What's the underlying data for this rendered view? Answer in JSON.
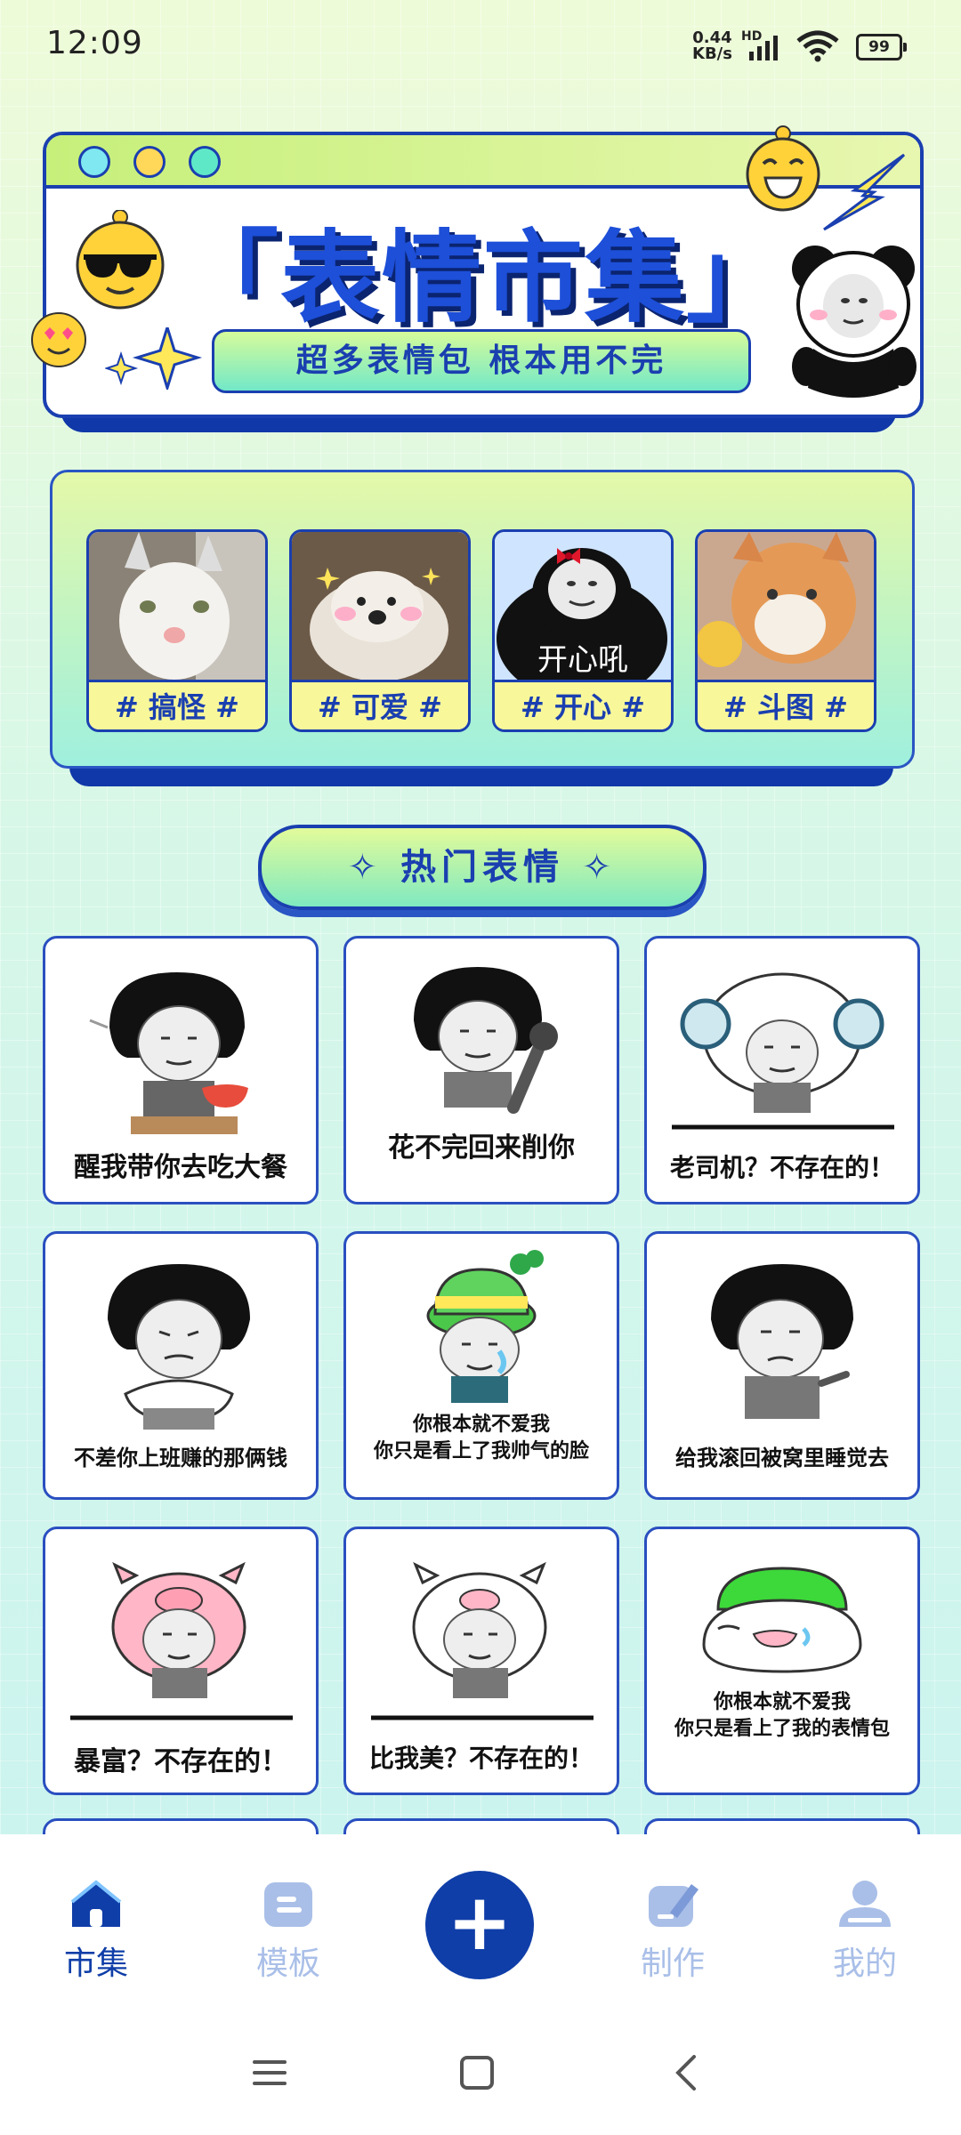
{
  "status": {
    "time": "12:09",
    "net_speed_value": "0.44",
    "net_speed_unit": "KB/s",
    "hd": "HD",
    "battery": "99"
  },
  "banner": {
    "title": "「表情市集」",
    "subtitle": "超多表情包 根本用不完"
  },
  "categories": [
    {
      "label": "# 搞怪 #",
      "overlay": ""
    },
    {
      "label": "# 可爱 #",
      "overlay": ""
    },
    {
      "label": "# 开心 #",
      "overlay": "开心吼"
    },
    {
      "label": "# 斗图 #",
      "overlay": ""
    }
  ],
  "hot": {
    "title": "✧ 热门表情 ✧"
  },
  "stickers": [
    {
      "caption": "醒我带你去吃大餐"
    },
    {
      "caption": "花不完回来削你"
    },
    {
      "caption": "老司机？不存在的！"
    },
    {
      "caption": "不差你上班赚的那俩钱"
    },
    {
      "caption_line1": "你根本就不爱我",
      "caption_line2": "你只是看上了我帅气的脸"
    },
    {
      "caption": "给我滚回被窝里睡觉去"
    },
    {
      "caption": "暴富？不存在的！"
    },
    {
      "caption": "比我美？不存在的！"
    },
    {
      "caption_line1": "你根本就不爱我",
      "caption_line2": "你只是看上了我的表情包"
    }
  ],
  "nav": {
    "items": [
      {
        "label": "市集",
        "icon": "home-icon",
        "active": true
      },
      {
        "label": "模板",
        "icon": "template-icon",
        "active": false
      },
      {
        "label": "制作",
        "icon": "edit-icon",
        "active": false
      },
      {
        "label": "我的",
        "icon": "user-icon",
        "active": false
      }
    ],
    "fab": "+"
  },
  "colors": {
    "accent": "#0f3ea8",
    "inactive": "#a9bfe8",
    "brand_blue": "#1a3fb0"
  }
}
